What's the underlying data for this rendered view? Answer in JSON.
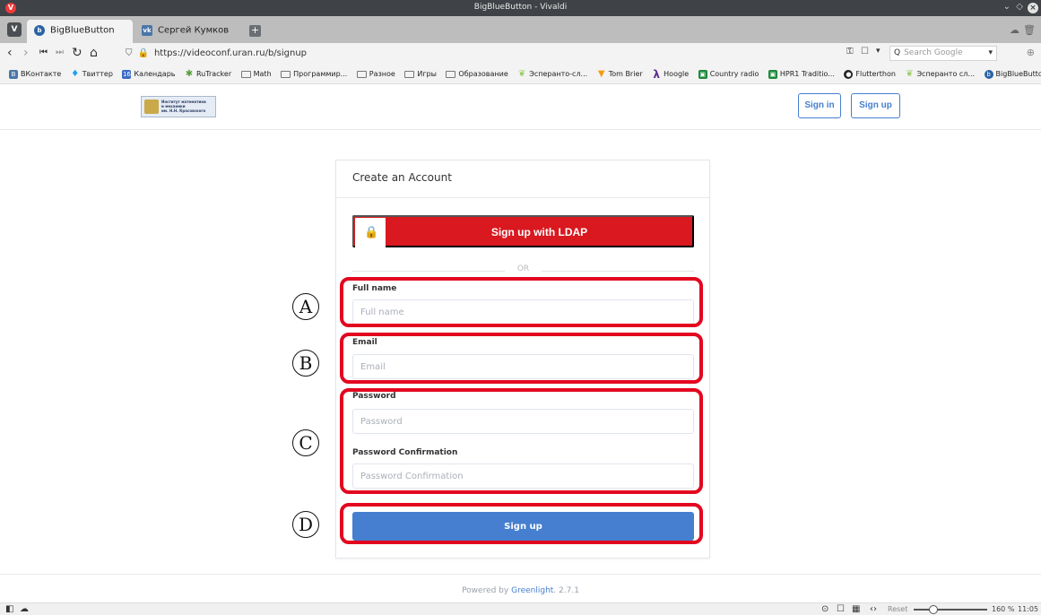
{
  "window": {
    "title": "BigBlueButton - Vivaldi"
  },
  "tabs": [
    {
      "label": "BigBlueButton",
      "active": true
    },
    {
      "label": "Сергей Кумков",
      "active": false
    }
  ],
  "address": {
    "url": "https://videoconf.uran.ru/b/signup",
    "search_placeholder": "Search Google"
  },
  "bookmarks": [
    {
      "label": "ВКонтакте",
      "icon": "vk-icon"
    },
    {
      "label": "Твиттер",
      "icon": "twitter-icon"
    },
    {
      "label": "Календарь",
      "icon": "calendar-icon"
    },
    {
      "label": "RuTracker",
      "icon": "rutracker-icon"
    },
    {
      "label": "Math",
      "icon": "folder-icon"
    },
    {
      "label": "Программир...",
      "icon": "folder-icon"
    },
    {
      "label": "Разное",
      "icon": "folder-icon"
    },
    {
      "label": "Игры",
      "icon": "folder-icon"
    },
    {
      "label": "Образование",
      "icon": "folder-icon"
    },
    {
      "label": "Эсперанто-сл...",
      "icon": "leaf-icon"
    },
    {
      "label": "Tom Brier",
      "icon": "cone-icon"
    },
    {
      "label": "Hoogle",
      "icon": "lambda-icon"
    },
    {
      "label": "Country radio",
      "icon": "radio-icon"
    },
    {
      "label": "HPR1 Traditio...",
      "icon": "radio-icon"
    },
    {
      "label": "Flutterthon",
      "icon": "github-icon"
    },
    {
      "label": "Эсперанто сл...",
      "icon": "leaf-icon"
    },
    {
      "label": "BigBlueButton",
      "icon": "bbb-icon"
    }
  ],
  "header": {
    "logo_lines": [
      "Институт математики",
      "и механики",
      "им. Н.Н. Красовского"
    ],
    "signin_label": "Sign in",
    "signup_label": "Sign up"
  },
  "card": {
    "title": "Create an Account",
    "ldap_label": "Sign up with LDAP",
    "or_label": "OR",
    "fields": {
      "fullname": {
        "label": "Full name",
        "placeholder": "Full name",
        "value": ""
      },
      "email": {
        "label": "Email",
        "placeholder": "Email",
        "value": ""
      },
      "password": {
        "label": "Password",
        "placeholder": "Password",
        "value": ""
      },
      "password_confirmation": {
        "label": "Password Confirmation",
        "placeholder": "Password Confirmation",
        "value": ""
      }
    },
    "submit_label": "Sign up"
  },
  "annotations": {
    "a": "A",
    "b": "B",
    "c": "C",
    "d": "D"
  },
  "footer": {
    "prefix": "Powered by ",
    "link": "Greenlight",
    "version": ". 2.7.1"
  },
  "status": {
    "reset_label": "Reset",
    "zoom": "160 %",
    "time": "11:05",
    "zoom_fraction": 0.2
  },
  "colors": {
    "primary": "#467fcf",
    "ldap_red": "#d9181f",
    "annotation_red": "#e2071f",
    "chrome_dark": "#3f4246"
  }
}
